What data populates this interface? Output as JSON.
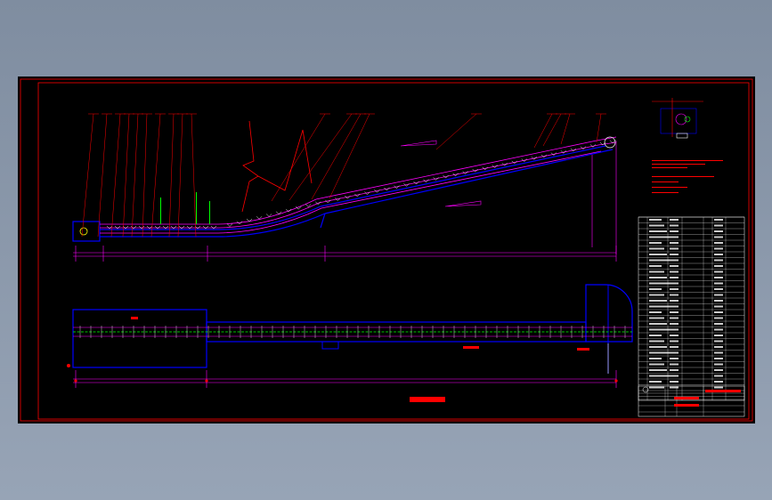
{
  "colors": {
    "background": "#000000",
    "viewport": "#8a98aa",
    "frame": "#ff0000",
    "belt": "#ff00ff",
    "structure": "#0000ff",
    "leader": "#ff0000",
    "dimension": "#ff00ff",
    "rollers": "#ffffff",
    "centerline": "#00ff00",
    "table_lines": "#ffffff",
    "table_text": "#ffffff",
    "highlight_text": "#ff0000"
  },
  "drawing": {
    "views": [
      "elevation-view",
      "plan-view",
      "detail-view",
      "notes",
      "parts-table",
      "title-block"
    ]
  }
}
